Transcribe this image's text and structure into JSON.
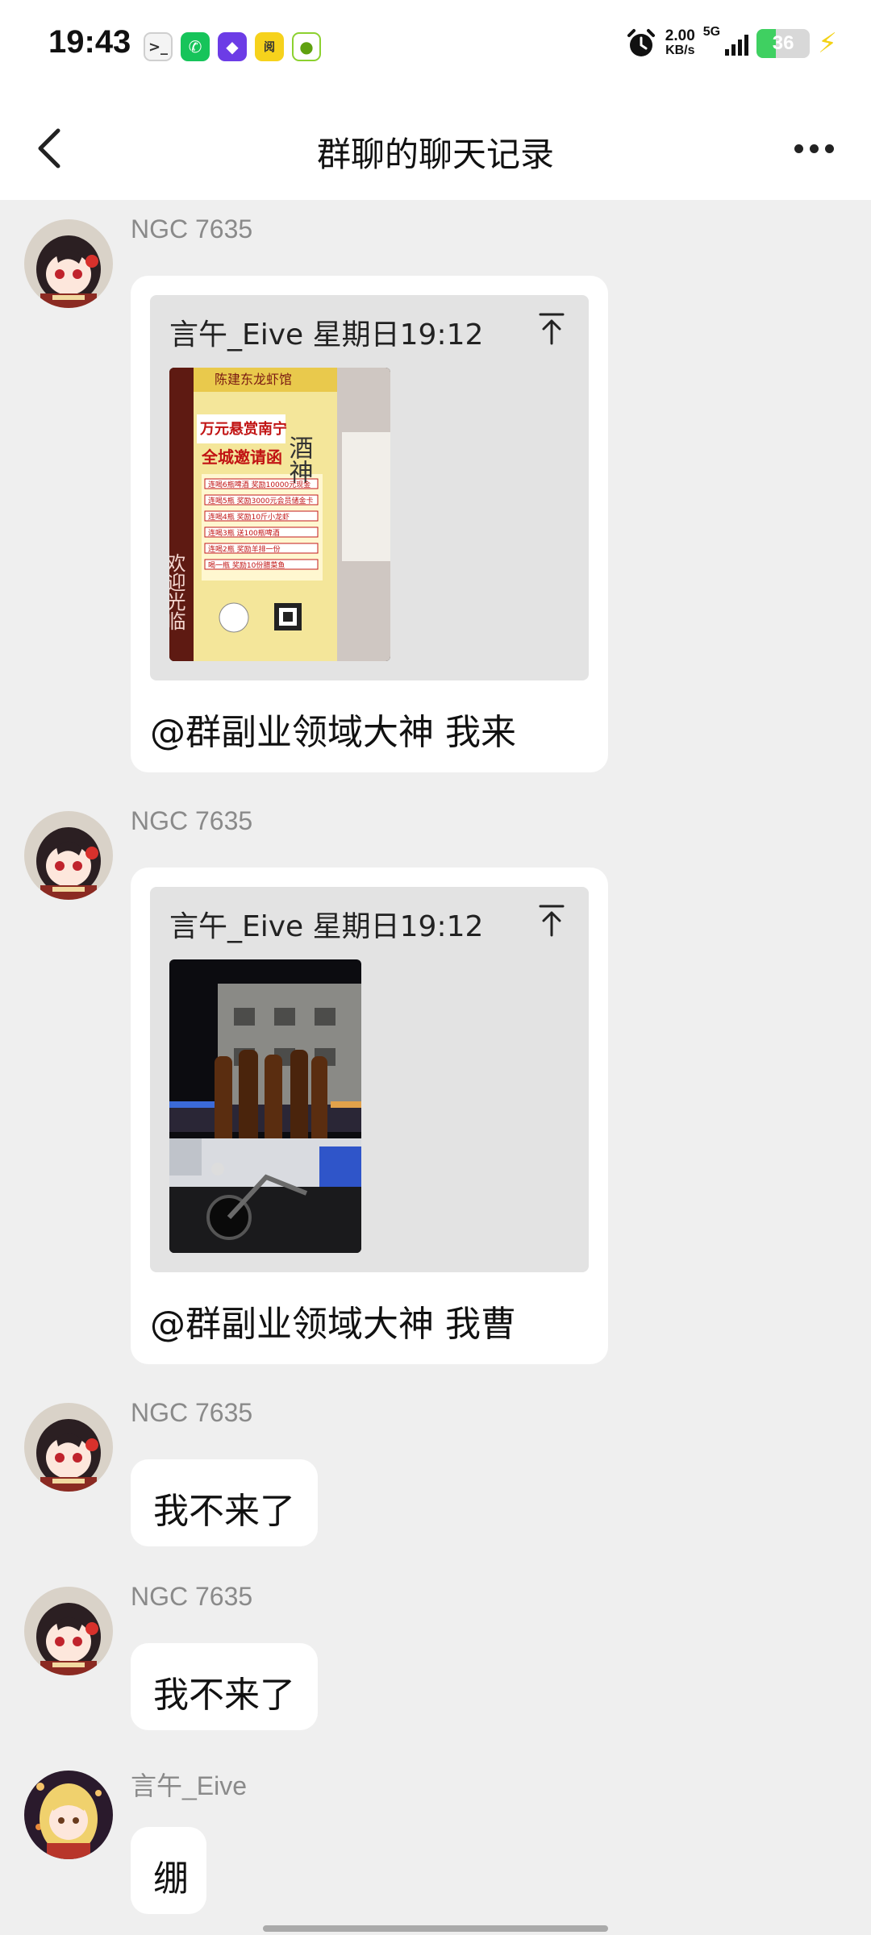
{
  "status_bar": {
    "time": "19:43",
    "net_speed_value": "2.00",
    "net_speed_unit": "KB/s",
    "network_type": "5G",
    "battery_percent": "36",
    "app_icons": [
      "terminal-icon",
      "phone-icon",
      "shortcut-icon",
      "reading-app-icon",
      "green-app-icon"
    ]
  },
  "header": {
    "title": "群聊的聊天记录",
    "back_icon": "chevron-left-icon",
    "more_icon": "more-dots-icon"
  },
  "messages": [
    {
      "sender": "NGC 7635",
      "type": "forwarded",
      "forwarded_header": "言午_Eive 星期日19:12",
      "image": {
        "banner_top": "陈建东龙虾馆",
        "headline_1": "万元悬赏南宁",
        "headline_2": "全城邀请函",
        "side_text": "酒神",
        "left_sign": "欢迎光临",
        "rules": [
          "连喝6瓶啤酒 奖励10000元现金",
          "连喝5瓶 奖励3000元会员储金卡",
          "连喝4瓶 奖励10斤小龙虾",
          "连喝3瓶 送100瓶啤酒",
          "连喝2瓶 奖励羊排一份",
          "喝一瓶 奖励10份腊菜鱼"
        ]
      },
      "caption": "@群副业领域大神 我来"
    },
    {
      "sender": "NGC 7635",
      "type": "forwarded",
      "forwarded_header": "言午_Eive 星期日19:12",
      "image": {
        "description_icon": "truck-with-giant-beer-bottles-photo"
      },
      "caption": "@群副业领域大神 我曹"
    },
    {
      "sender": "NGC 7635",
      "type": "text",
      "text": "我不来了"
    },
    {
      "sender": "NGC 7635",
      "type": "text",
      "text": "我不来了"
    },
    {
      "sender": "言午_Eive",
      "type": "text",
      "text": "绷"
    }
  ],
  "colors": {
    "background": "#efefef",
    "bubble": "#ffffff",
    "forward_card": "#e3e3e3",
    "sender_name": "#8a8a8a",
    "battery_green": "#3fd061"
  }
}
